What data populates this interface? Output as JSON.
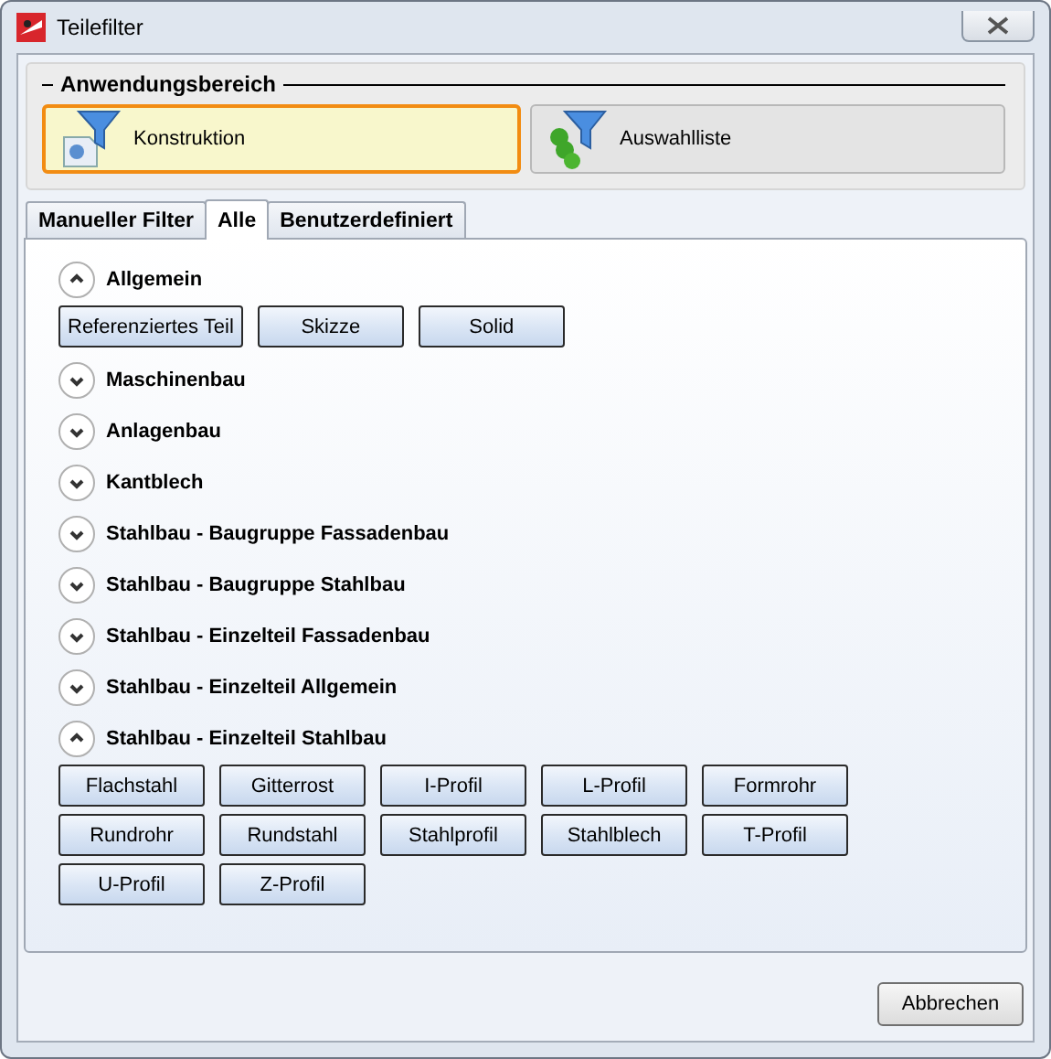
{
  "window": {
    "title": "Teilefilter"
  },
  "scope": {
    "title": "Anwendungsbereich",
    "options": [
      {
        "label": "Konstruktion",
        "kind": "construction",
        "selected": true
      },
      {
        "label": "Auswahlliste",
        "kind": "list",
        "selected": false
      }
    ]
  },
  "tabs": [
    {
      "label": "Manueller Filter",
      "selected": false
    },
    {
      "label": "Alle",
      "selected": true
    },
    {
      "label": "Benutzerdefiniert",
      "selected": false
    }
  ],
  "sections": [
    {
      "title": "Allgemein",
      "expanded": true,
      "items": [
        "Referenziertes Teil",
        "Skizze",
        "Solid"
      ]
    },
    {
      "title": "Maschinenbau",
      "expanded": false
    },
    {
      "title": "Anlagenbau",
      "expanded": false
    },
    {
      "title": "Kantblech",
      "expanded": false
    },
    {
      "title": "Stahlbau - Baugruppe Fassadenbau",
      "expanded": false
    },
    {
      "title": "Stahlbau - Baugruppe Stahlbau",
      "expanded": false
    },
    {
      "title": "Stahlbau - Einzelteil Fassadenbau",
      "expanded": false
    },
    {
      "title": "Stahlbau - Einzelteil Allgemein",
      "expanded": false
    },
    {
      "title": "Stahlbau - Einzelteil Stahlbau",
      "expanded": true,
      "items": [
        "Flachstahl",
        "Gitterrost",
        "I-Profil",
        "L-Profil",
        "Formrohr",
        "Rundrohr",
        "Rundstahl",
        "Stahlprofil",
        "Stahlblech",
        "T-Profil",
        "U-Profil",
        "Z-Profil"
      ]
    }
  ],
  "buttons": [
    "Abbrechen"
  ]
}
